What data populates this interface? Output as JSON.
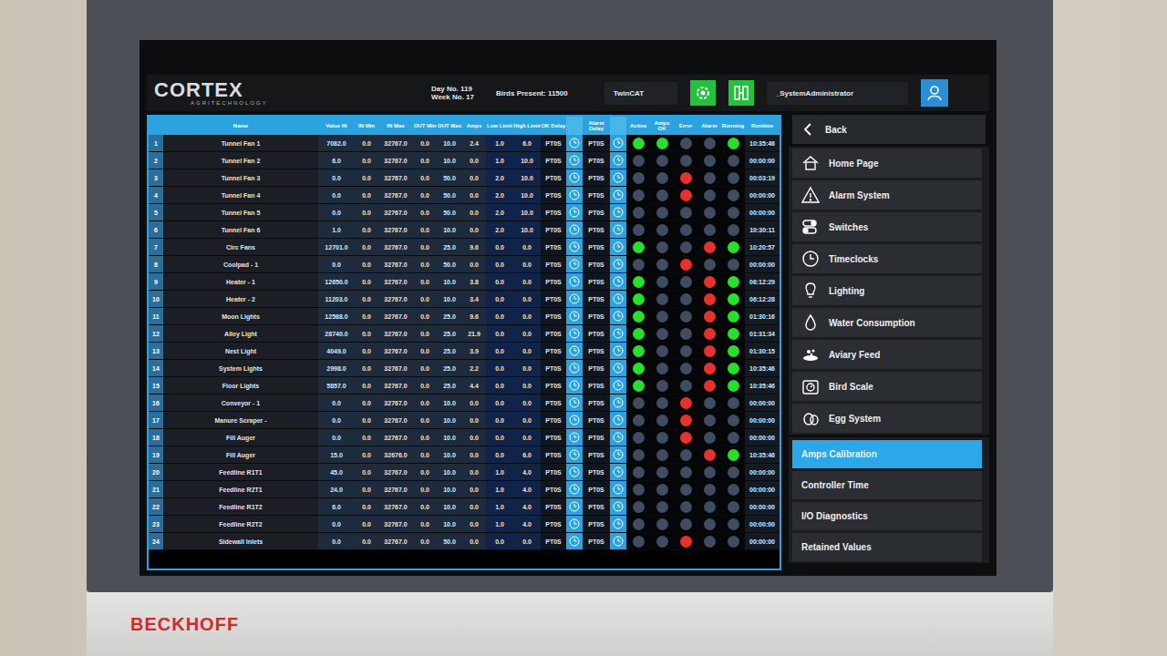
{
  "device": {
    "brand": "BECKHOFF"
  },
  "header": {
    "logo": "CORTEX",
    "logo_sub": "AGRITECHNOLOGY",
    "day": "Day No. 119",
    "week": "Week No. 17",
    "birds": "Birds Present: 11500",
    "runtime_label": "TwinCAT",
    "user": "_SystemAdministrator"
  },
  "table": {
    "columns": [
      {
        "label": "",
        "kind": "no"
      },
      {
        "label": "Name",
        "kind": "name"
      },
      {
        "label": "Value IN",
        "kind": "num"
      },
      {
        "label": "IN Min",
        "kind": "num"
      },
      {
        "label": "IN Max",
        "kind": "num"
      },
      {
        "label": "OUT Min",
        "kind": "num"
      },
      {
        "label": "OUT Max",
        "kind": "num"
      },
      {
        "label": "Amps",
        "kind": "num"
      },
      {
        "label": "Low Limit",
        "kind": "limit"
      },
      {
        "label": "High Limit",
        "kind": "limit"
      },
      {
        "label": "OK Delay",
        "kind": "delay"
      },
      {
        "label": "",
        "kind": "clock"
      },
      {
        "label": "Alarm Delay",
        "kind": "delay"
      },
      {
        "label": "",
        "kind": "clock"
      },
      {
        "label": "Active",
        "kind": "dot"
      },
      {
        "label": "Amps OK",
        "kind": "dot"
      },
      {
        "label": "Error",
        "kind": "dot"
      },
      {
        "label": "Alarm",
        "kind": "dot"
      },
      {
        "label": "Running",
        "kind": "dot"
      },
      {
        "label": "Runtime",
        "kind": "time"
      }
    ],
    "rows": [
      {
        "no": "1",
        "name": "Tunnel Fan 1",
        "values": [
          "7082.0",
          "0.0",
          "32767.0",
          "0.0",
          "10.0",
          "2.4",
          "1.0",
          "6.0"
        ],
        "ok_delay": "PT0S",
        "alarm_delay": "PT0S",
        "active": true,
        "amps_ok": true,
        "error": false,
        "alarm": false,
        "running": true,
        "runtime": "10:35:46"
      },
      {
        "no": "2",
        "name": "Tunnel Fan 2",
        "values": [
          "6.0",
          "0.0",
          "32767.0",
          "0.0",
          "10.0",
          "0.0",
          "1.0",
          "10.0"
        ],
        "ok_delay": "PT0S",
        "alarm_delay": "PT0S",
        "active": false,
        "amps_ok": false,
        "error": false,
        "alarm": false,
        "running": false,
        "runtime": "00:00:00"
      },
      {
        "no": "3",
        "name": "Tunnel Fan 3",
        "values": [
          "0.0",
          "0.0",
          "32767.0",
          "0.0",
          "50.0",
          "0.0",
          "2.0",
          "10.0"
        ],
        "ok_delay": "PT0S",
        "alarm_delay": "PT0S",
        "active": false,
        "amps_ok": false,
        "error": true,
        "alarm": false,
        "running": false,
        "runtime": "00:03:19"
      },
      {
        "no": "4",
        "name": "Tunnel Fan 4",
        "values": [
          "0.0",
          "0.0",
          "32767.0",
          "0.0",
          "50.0",
          "0.0",
          "2.0",
          "10.0"
        ],
        "ok_delay": "PT0S",
        "alarm_delay": "PT0S",
        "active": false,
        "amps_ok": false,
        "error": true,
        "alarm": false,
        "running": false,
        "runtime": "00:00:00"
      },
      {
        "no": "5",
        "name": "Tunnel Fan 5",
        "values": [
          "0.0",
          "0.0",
          "32767.0",
          "0.0",
          "50.0",
          "0.0",
          "2.0",
          "10.0"
        ],
        "ok_delay": "PT0S",
        "alarm_delay": "PT0S",
        "active": false,
        "amps_ok": false,
        "error": false,
        "alarm": false,
        "running": false,
        "runtime": "00:00:00"
      },
      {
        "no": "6",
        "name": "Tunnel Fan 6",
        "values": [
          "1.0",
          "0.0",
          "32767.0",
          "0.0",
          "10.0",
          "0.0",
          "2.0",
          "10.0"
        ],
        "ok_delay": "PT0S",
        "alarm_delay": "PT0S",
        "active": false,
        "amps_ok": false,
        "error": false,
        "alarm": false,
        "running": false,
        "runtime": "10:30:11"
      },
      {
        "no": "7",
        "name": "Circ Fans",
        "values": [
          "12701.0",
          "0.0",
          "32767.0",
          "0.0",
          "25.0",
          "9.6",
          "0.0",
          "0.0"
        ],
        "ok_delay": "PT0S",
        "alarm_delay": "PT0S",
        "active": true,
        "amps_ok": false,
        "error": false,
        "alarm": true,
        "running": true,
        "runtime": "10:20:57"
      },
      {
        "no": "8",
        "name": "Coolpad - 1",
        "values": [
          "0.0",
          "0.0",
          "32767.0",
          "0.0",
          "50.0",
          "0.0",
          "0.0",
          "0.0"
        ],
        "ok_delay": "PT0S",
        "alarm_delay": "PT0S",
        "active": false,
        "amps_ok": false,
        "error": true,
        "alarm": false,
        "running": false,
        "runtime": "00:00:00"
      },
      {
        "no": "9",
        "name": "Heater - 1",
        "values": [
          "12650.0",
          "0.0",
          "32767.0",
          "0.0",
          "10.0",
          "3.8",
          "0.0",
          "0.0"
        ],
        "ok_delay": "PT0S",
        "alarm_delay": "PT0S",
        "active": true,
        "amps_ok": false,
        "error": false,
        "alarm": true,
        "running": true,
        "runtime": "06:12:29"
      },
      {
        "no": "10",
        "name": "Heater - 2",
        "values": [
          "11203.0",
          "0.0",
          "32767.0",
          "0.0",
          "10.0",
          "3.4",
          "0.0",
          "0.0"
        ],
        "ok_delay": "PT0S",
        "alarm_delay": "PT0S",
        "active": true,
        "amps_ok": false,
        "error": false,
        "alarm": true,
        "running": true,
        "runtime": "06:12:28"
      },
      {
        "no": "11",
        "name": "Moon Lights",
        "values": [
          "12588.0",
          "0.0",
          "32767.0",
          "0.0",
          "25.0",
          "9.6",
          "0.0",
          "0.0"
        ],
        "ok_delay": "PT0S",
        "alarm_delay": "PT0S",
        "active": true,
        "amps_ok": false,
        "error": false,
        "alarm": true,
        "running": true,
        "runtime": "01:30:16"
      },
      {
        "no": "12",
        "name": "Alley Light",
        "values": [
          "28740.0",
          "0.0",
          "32767.0",
          "0.0",
          "25.0",
          "21.9",
          "0.0",
          "0.0"
        ],
        "ok_delay": "PT0S",
        "alarm_delay": "PT0S",
        "active": true,
        "amps_ok": false,
        "error": false,
        "alarm": true,
        "running": true,
        "runtime": "01:31:34"
      },
      {
        "no": "13",
        "name": "Nest Light",
        "values": [
          "4049.0",
          "0.0",
          "32767.0",
          "0.0",
          "25.0",
          "3.9",
          "0.0",
          "0.0"
        ],
        "ok_delay": "PT0S",
        "alarm_delay": "PT0S",
        "active": true,
        "amps_ok": false,
        "error": false,
        "alarm": true,
        "running": true,
        "runtime": "01:30:15"
      },
      {
        "no": "14",
        "name": "System Lights",
        "values": [
          "2998.0",
          "0.0",
          "32767.0",
          "0.0",
          "25.0",
          "2.2",
          "0.0",
          "0.0"
        ],
        "ok_delay": "PT0S",
        "alarm_delay": "PT0S",
        "active": true,
        "amps_ok": false,
        "error": false,
        "alarm": true,
        "running": true,
        "runtime": "10:35:46"
      },
      {
        "no": "15",
        "name": "Floor Lights",
        "values": [
          "5857.0",
          "0.0",
          "32767.0",
          "0.0",
          "25.0",
          "4.4",
          "0.0",
          "0.0"
        ],
        "ok_delay": "PT0S",
        "alarm_delay": "PT0S",
        "active": true,
        "amps_ok": false,
        "error": false,
        "alarm": true,
        "running": true,
        "runtime": "10:35:46"
      },
      {
        "no": "16",
        "name": "Conveyor - 1",
        "values": [
          "0.0",
          "0.0",
          "32767.0",
          "0.0",
          "10.0",
          "0.0",
          "0.0",
          "0.0"
        ],
        "ok_delay": "PT0S",
        "alarm_delay": "PT0S",
        "active": false,
        "amps_ok": false,
        "error": true,
        "alarm": false,
        "running": false,
        "runtime": "00:00:00"
      },
      {
        "no": "17",
        "name": "Manure Scraper -",
        "values": [
          "0.0",
          "0.0",
          "32767.0",
          "0.0",
          "10.0",
          "0.0",
          "0.0",
          "0.0"
        ],
        "ok_delay": "PT0S",
        "alarm_delay": "PT0S",
        "active": false,
        "amps_ok": false,
        "error": true,
        "alarm": false,
        "running": false,
        "runtime": "00:00:00"
      },
      {
        "no": "18",
        "name": "Fill Auger",
        "values": [
          "0.0",
          "0.0",
          "32767.0",
          "0.0",
          "10.0",
          "0.0",
          "0.0",
          "0.0"
        ],
        "ok_delay": "PT0S",
        "alarm_delay": "PT0S",
        "active": false,
        "amps_ok": false,
        "error": true,
        "alarm": false,
        "running": false,
        "runtime": "00:00:00"
      },
      {
        "no": "19",
        "name": "Fill Auger",
        "values": [
          "15.0",
          "0.0",
          "32676.0",
          "0.0",
          "10.0",
          "0.0",
          "0.0",
          "6.0"
        ],
        "ok_delay": "PT0S",
        "alarm_delay": "PT0S",
        "active": false,
        "amps_ok": false,
        "error": false,
        "alarm": true,
        "running": true,
        "runtime": "10:35:46"
      },
      {
        "no": "20",
        "name": "Feedline R1T1",
        "values": [
          "45.0",
          "0.0",
          "32767.0",
          "0.0",
          "10.0",
          "0.0",
          "1.0",
          "4.0"
        ],
        "ok_delay": "PT0S",
        "alarm_delay": "PT0S",
        "active": false,
        "amps_ok": false,
        "error": false,
        "alarm": false,
        "running": false,
        "runtime": "00:00:00"
      },
      {
        "no": "21",
        "name": "Feedline R2T1",
        "values": [
          "24.0",
          "0.0",
          "32767.0",
          "0.0",
          "10.0",
          "0.0",
          "1.0",
          "4.0"
        ],
        "ok_delay": "PT0S",
        "alarm_delay": "PT0S",
        "active": false,
        "amps_ok": false,
        "error": false,
        "alarm": false,
        "running": false,
        "runtime": "00:00:00"
      },
      {
        "no": "22",
        "name": "Feedline R1T2",
        "values": [
          "6.0",
          "0.0",
          "32767.0",
          "0.0",
          "10.0",
          "0.0",
          "1.0",
          "4.0"
        ],
        "ok_delay": "PT0S",
        "alarm_delay": "PT0S",
        "active": false,
        "amps_ok": false,
        "error": false,
        "alarm": false,
        "running": false,
        "runtime": "00:00:00"
      },
      {
        "no": "23",
        "name": "Feedline R2T2",
        "values": [
          "0.0",
          "0.0",
          "32767.0",
          "0.0",
          "10.0",
          "0.0",
          "1.0",
          "4.0"
        ],
        "ok_delay": "PT0S",
        "alarm_delay": "PT0S",
        "active": false,
        "amps_ok": false,
        "error": false,
        "alarm": false,
        "running": false,
        "runtime": "00:00:00"
      },
      {
        "no": "24",
        "name": "Sidewall Inlets",
        "values": [
          "0.0",
          "0.0",
          "32767.0",
          "0.0",
          "50.0",
          "0.0",
          "0.0",
          "0.0"
        ],
        "ok_delay": "PT0S",
        "alarm_delay": "PT0S",
        "active": false,
        "amps_ok": false,
        "error": true,
        "alarm": false,
        "running": false,
        "runtime": "00:00:00"
      }
    ]
  },
  "sidebar": {
    "back": "Back",
    "items": [
      {
        "label": "Home Page",
        "kind": "icon",
        "selected": false
      },
      {
        "label": "Alarm System",
        "kind": "icon",
        "selected": false
      },
      {
        "label": "Switches",
        "kind": "icon",
        "selected": false
      },
      {
        "label": "Timeclocks",
        "kind": "icon",
        "selected": false
      },
      {
        "label": "Lighting",
        "kind": "icon",
        "selected": false
      },
      {
        "label": "Water Consumption",
        "kind": "icon",
        "selected": false
      },
      {
        "label": "Aviary Feed",
        "kind": "icon",
        "selected": false
      },
      {
        "label": "Bird Scale",
        "kind": "icon",
        "selected": false
      },
      {
        "label": "Egg System",
        "kind": "icon",
        "selected": false
      },
      {
        "label": "Amps Calibration",
        "kind": "plain",
        "selected": true
      },
      {
        "label": "Controller Time",
        "kind": "plain",
        "selected": false
      },
      {
        "label": "I/O Diagnostics",
        "kind": "plain",
        "selected": false
      },
      {
        "label": "Retained Values",
        "kind": "plain",
        "selected": false
      }
    ]
  }
}
